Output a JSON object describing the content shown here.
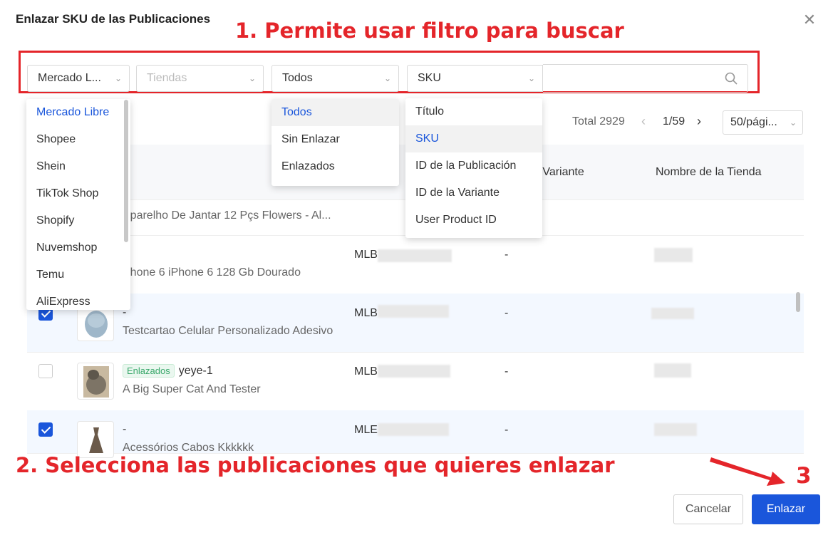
{
  "dialog": {
    "title": "Enlazar SKU de las Publicaciones",
    "close_icon": "close-icon"
  },
  "annotations": {
    "step1": "1. Permite usar filtro para buscar",
    "step2": "2. Selecciona las publicaciones que quieres enlazar",
    "step3": "3"
  },
  "filters": {
    "platform_value": "Mercado L...",
    "stores_placeholder": "Tiendas",
    "status_value": "Todos",
    "field_value": "SKU",
    "search_value": ""
  },
  "platform_options": [
    "Mercado Libre",
    "Shopee",
    "Shein",
    "TikTok Shop",
    "Shopify",
    "Nuvemshop",
    "Temu",
    "AliExpress"
  ],
  "status_options": [
    "Todos",
    "Sin Enlazar",
    "Enlazados"
  ],
  "field_options": [
    "Título",
    "SKU",
    "ID de la Publicación",
    "ID de la Variante",
    "User Product ID"
  ],
  "pagination": {
    "total": "Total 2929",
    "page": "1/59",
    "page_size": "50/pági..."
  },
  "table": {
    "headers": {
      "variant": "e Variante",
      "store": "Nombre de la Tienda"
    },
    "rows": [
      {
        "tag": "",
        "sku": "-",
        "title": "Phone 6 iPhone 6 128 Gb Dourado",
        "mlb": "MLB",
        "variant": "-"
      },
      {
        "tag": "",
        "sku": "-",
        "title": "Testcartao Celular Personalizado Adesivo",
        "mlb": "MLB",
        "variant": "-"
      },
      {
        "tag": "Enlazados",
        "sku": "yeye-1",
        "title": "A Big Super Cat And Tester",
        "mlb": "MLB",
        "variant": "-"
      },
      {
        "tag": "",
        "sku": "-",
        "title": "Acessórios Cabos Kkkkkk",
        "mlb": "MLE",
        "variant": "-"
      }
    ],
    "partial_row": {
      "title": "Aparelho De Jantar 12 Pçs Flowers - Al..."
    }
  },
  "buttons": {
    "cancel": "Cancelar",
    "confirm": "Enlazar"
  },
  "colors": {
    "accent": "#1a56db",
    "annotation": "#e4252a",
    "tag_green": "#3aa86b"
  }
}
